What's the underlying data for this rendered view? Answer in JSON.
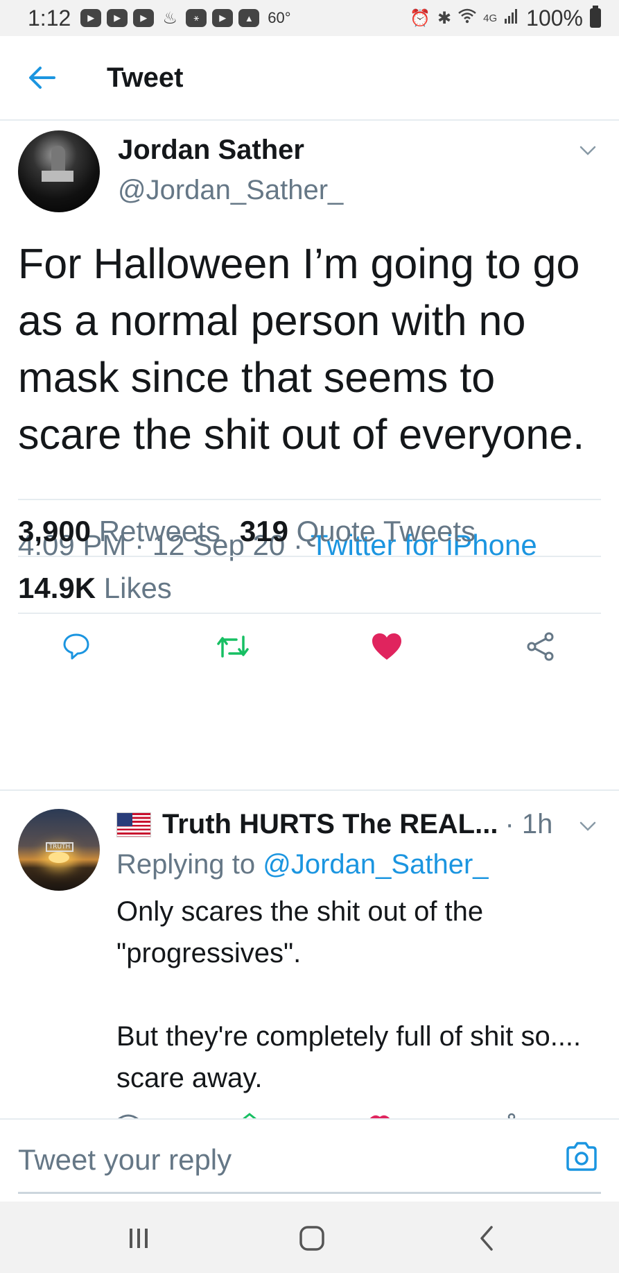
{
  "status_bar": {
    "time": "1:12",
    "temperature": "60°",
    "network": "4G",
    "battery": "100%",
    "icons_left": [
      "youtube-icon",
      "youtube-icon",
      "youtube-icon",
      "app-icon",
      "app-icon",
      "youtube-icon",
      "gallery-icon"
    ],
    "icons_right": [
      "alarm-icon",
      "bluetooth-icon",
      "wifi-icon",
      "signal-icon",
      "battery-icon"
    ]
  },
  "header": {
    "title": "Tweet"
  },
  "tweet": {
    "author_name": "Jordan Sather",
    "author_handle": "@Jordan_Sather_",
    "text": "For Halloween I’m going to go as a normal person with no mask since that seems to scare the shit out of everyone.",
    "time": "4:09 PM",
    "date": "12 Sep 20",
    "separator": "·",
    "source": "Twitter for iPhone",
    "retweets_count": "3,900",
    "retweets_label": "Retweets",
    "quote_count": "319",
    "quote_label": "Quote Tweets",
    "likes_count": "14.9K",
    "likes_label": "Likes",
    "liked": true
  },
  "reply": {
    "author_name": "Truth HURTS The REAL...",
    "time": "· 1h",
    "replying_prefix": "Replying to",
    "replying_to": "@Jordan_Sather_",
    "text": "Only scares the shit out of the \"progressives\".\n\nBut they're completely full of shit so.... scare away.",
    "avatar_sign": "TRUTH"
  },
  "composer": {
    "placeholder": "Tweet your reply"
  },
  "colors": {
    "accent": "#1b95e0",
    "secondary_text": "#657786",
    "retweet_green": "#17bf63",
    "like_red": "#e0245e",
    "divider": "#e6ecf0"
  }
}
